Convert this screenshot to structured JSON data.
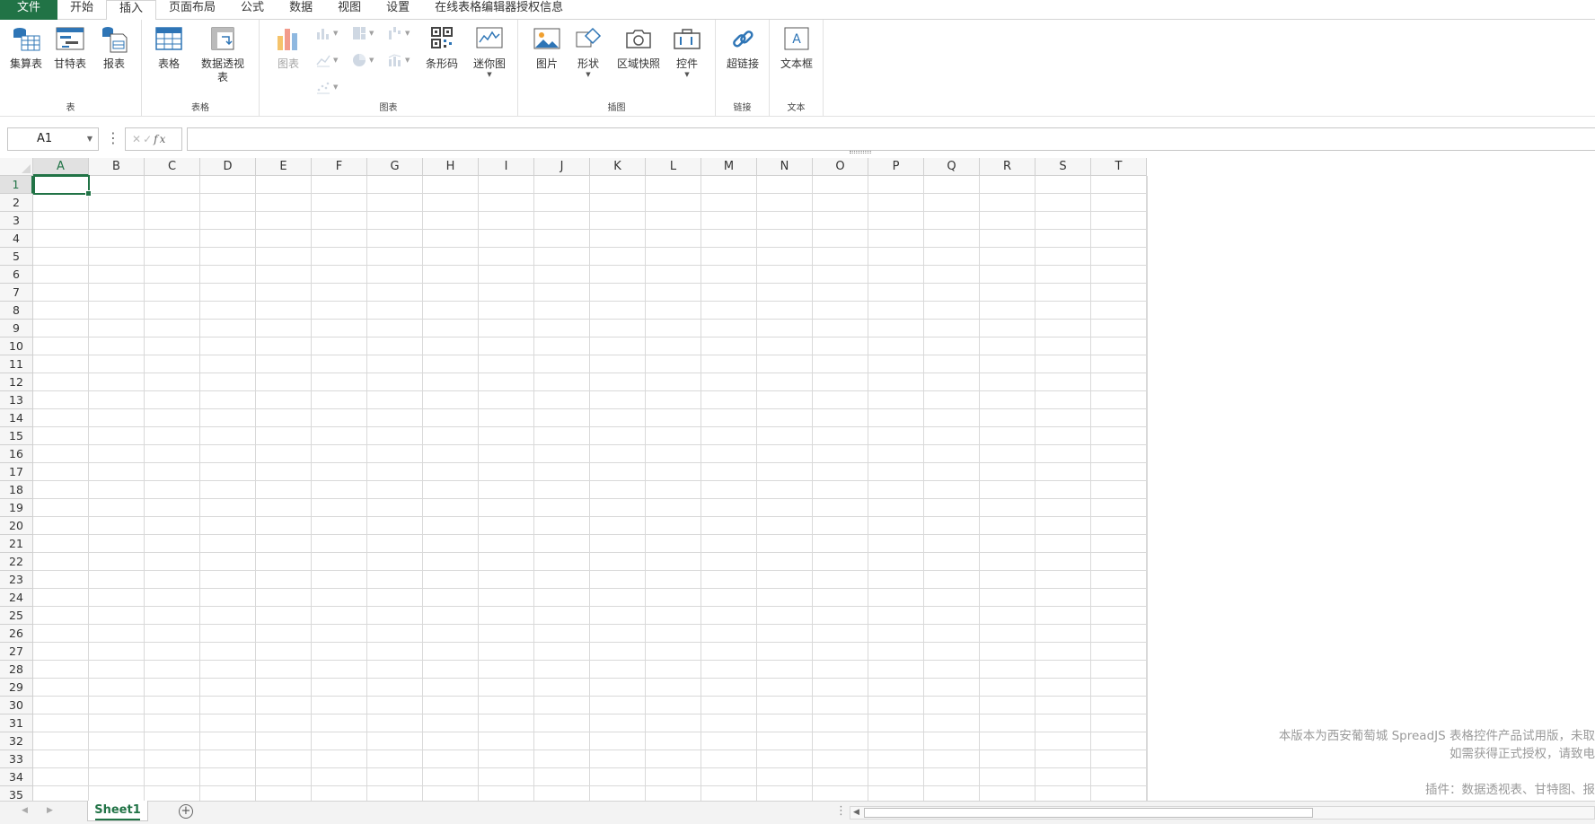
{
  "tabs": [
    {
      "label": "文件",
      "kind": "file"
    },
    {
      "label": "开始"
    },
    {
      "label": "插入",
      "active": true
    },
    {
      "label": "页面布局"
    },
    {
      "label": "公式"
    },
    {
      "label": "数据"
    },
    {
      "label": "视图"
    },
    {
      "label": "设置"
    },
    {
      "label": "在线表格编辑器授权信息"
    }
  ],
  "ribbon": {
    "groups": {
      "table": "表",
      "tables": "表格",
      "charts": "图表",
      "illustrations": "插图",
      "links": "链接",
      "text": "文本"
    },
    "buttons": {
      "report_sheet": "集算表",
      "gantt": "甘特表",
      "report": "报表",
      "table": "表格",
      "pivot": "数据透视表",
      "chart": "图表",
      "barcode": "条形码",
      "sparkline": "迷你图",
      "picture": "图片",
      "shape": "形状",
      "camera": "区域快照",
      "control": "控件",
      "hyperlink": "超链接",
      "textbox": "文本框"
    }
  },
  "formula_bar": {
    "name_box": "A1",
    "cancel": "✕",
    "enter": "✓",
    "fx": "fx",
    "value": ""
  },
  "grid": {
    "columns": [
      "A",
      "B",
      "C",
      "D",
      "E",
      "F",
      "G",
      "H",
      "I",
      "J",
      "K",
      "L",
      "M",
      "N",
      "O",
      "P",
      "Q",
      "R",
      "S",
      "T"
    ],
    "rows": [
      "1",
      "2",
      "3",
      "4",
      "5",
      "6",
      "7",
      "8",
      "9",
      "10",
      "11",
      "12",
      "13",
      "14",
      "15",
      "16",
      "17",
      "18",
      "19",
      "20",
      "21",
      "22",
      "23",
      "24",
      "25",
      "26",
      "27",
      "28",
      "29",
      "30",
      "31",
      "32",
      "33",
      "34",
      "35"
    ],
    "active_cell": "A1"
  },
  "watermark": {
    "line1": "本版本为西安葡萄城 SpreadJS 表格控件产品试用版，未取",
    "line2": "如需获得正式授权，请致电",
    "line3": "插件：数据透视表、甘特图、报"
  },
  "sheets": {
    "tabs": [
      "Sheet1"
    ],
    "active": "Sheet1",
    "add_label": "+"
  },
  "colors": {
    "accent": "#217346",
    "grid_line": "#d9d9d9",
    "header_bg": "#f6f6f6",
    "icon_blue": "#2e75b6"
  }
}
